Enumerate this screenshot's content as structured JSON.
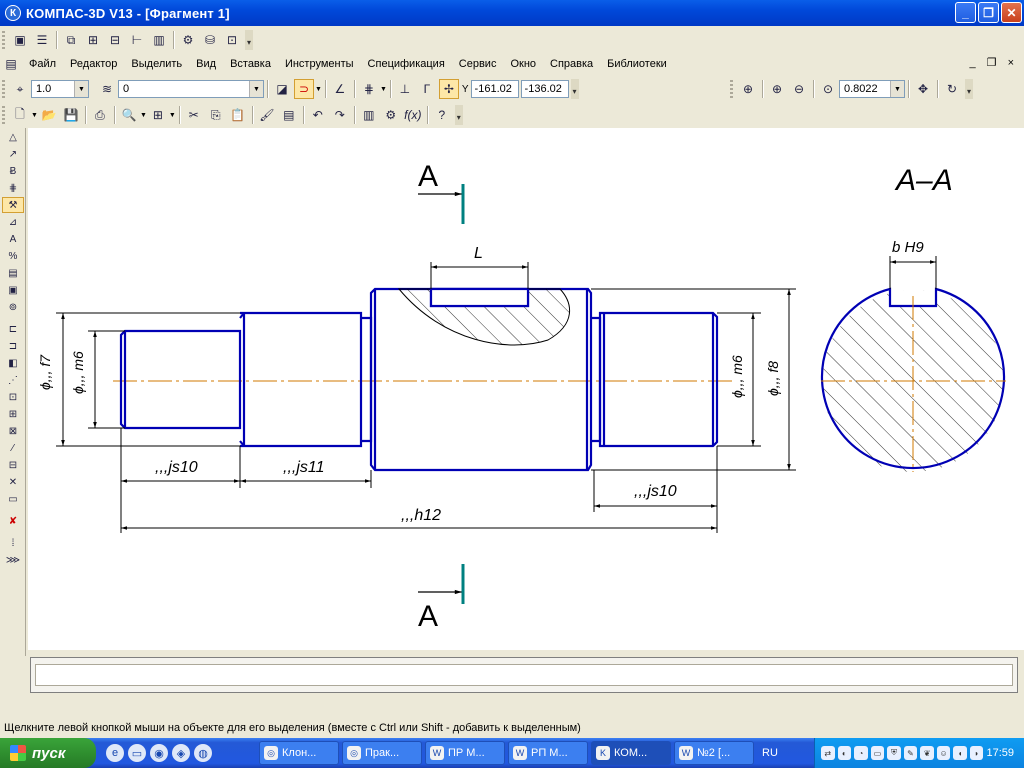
{
  "window": {
    "title": "КОМПАС-3D V13 - [Фрагмент 1]",
    "app_icon": "К",
    "buttons": [
      "_",
      "❐",
      "✕"
    ]
  },
  "menu": {
    "items": [
      "Файл",
      "Редактор",
      "Выделить",
      "Вид",
      "Вставка",
      "Инструменты",
      "Спецификация",
      "Сервис",
      "Окно",
      "Справка",
      "Библиотеки"
    ],
    "mdi_buttons": "_ ❐ ×"
  },
  "current_state": {
    "step_value": "1.0",
    "layer_value": "0",
    "coord_x": "-161.02",
    "coord_y": "-136.02",
    "zoom_value": "0.8022",
    "coord_label": "Y"
  },
  "drawing": {
    "section_letter_top": "A",
    "section_letter_bottom": "A",
    "section_title": "A–A",
    "dim_L": "L",
    "dim_key": "b H9",
    "dim_d_f7": "ϕ,,, f7",
    "dim_d_m6_left": "ϕ,,, m6",
    "dim_d_m6_right": "ϕ,,, m6",
    "dim_d_f8": "ϕ,,, f8",
    "dim_js10_left": ",,,js10",
    "dim_js11": ",,,js11",
    "dim_js10_right": ",,,js10",
    "dim_h12": ",,,h12",
    "colors": {
      "geometry": "#0000b4",
      "centerline": "#d07a00",
      "dims": "#000000",
      "section_mark": "#008080"
    }
  },
  "status": {
    "hint": "Щелкните левой кнопкой мыши на объекте для его выделения (вместе с Ctrl или Shift - добавить к выделенным)"
  },
  "taskbar": {
    "start_label": "пуск",
    "tasks": [
      "Клон...",
      "Прак...",
      "ПР М...",
      "РП М...",
      "КОМ...",
      "№2 [..."
    ],
    "active_task_index": 4,
    "language": "RU",
    "clock": "17:59"
  }
}
